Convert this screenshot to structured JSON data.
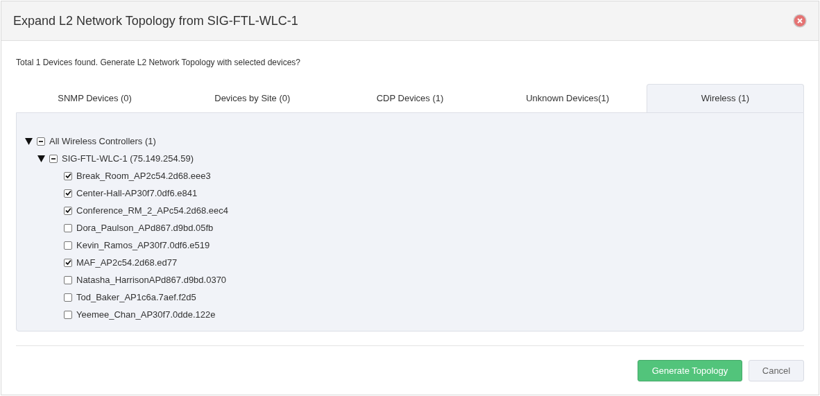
{
  "dialog": {
    "title": "Expand L2 Network Topology from SIG-FTL-WLC-1",
    "message": "Total 1 Devices found. Generate L2 Network Topology with selected devices?"
  },
  "tabs": [
    {
      "label": "SNMP Devices (0)",
      "selected": false
    },
    {
      "label": "Devices by Site (0)",
      "selected": false
    },
    {
      "label": "CDP Devices (1)",
      "selected": false
    },
    {
      "label": "Unknown Devices(1)",
      "selected": false
    },
    {
      "label": "Wireless (1)",
      "selected": true
    }
  ],
  "tree": [
    {
      "label": "All Wireless Controllers (1)",
      "expanded": true,
      "partial": true,
      "children": [
        {
          "label": "SIG-FTL-WLC-1 (75.149.254.59)",
          "expanded": true,
          "partial": true,
          "children": [
            {
              "label": "Break_Room_AP2c54.2d68.eee3",
              "checked": true
            },
            {
              "label": "Center-Hall-AP30f7.0df6.e841",
              "checked": true
            },
            {
              "label": "Conference_RM_2_APc54.2d68.eec4",
              "checked": true
            },
            {
              "label": "Dora_Paulson_APd867.d9bd.05fb",
              "checked": false
            },
            {
              "label": "Kevin_Ramos_AP30f7.0df6.e519",
              "checked": false
            },
            {
              "label": "MAF_AP2c54.2d68.ed77",
              "checked": true
            },
            {
              "label": "Natasha_HarrisonAPd867.d9bd.0370",
              "checked": false
            },
            {
              "label": "Tod_Baker_AP1c6a.7aef.f2d5",
              "checked": false
            },
            {
              "label": "Yeemee_Chan_AP30f7.0dde.122e",
              "checked": false
            }
          ]
        }
      ]
    }
  ],
  "buttons": [
    {
      "label": "Generate Topology",
      "kind": "primary"
    },
    {
      "label": "Cancel",
      "kind": "secondary"
    }
  ]
}
